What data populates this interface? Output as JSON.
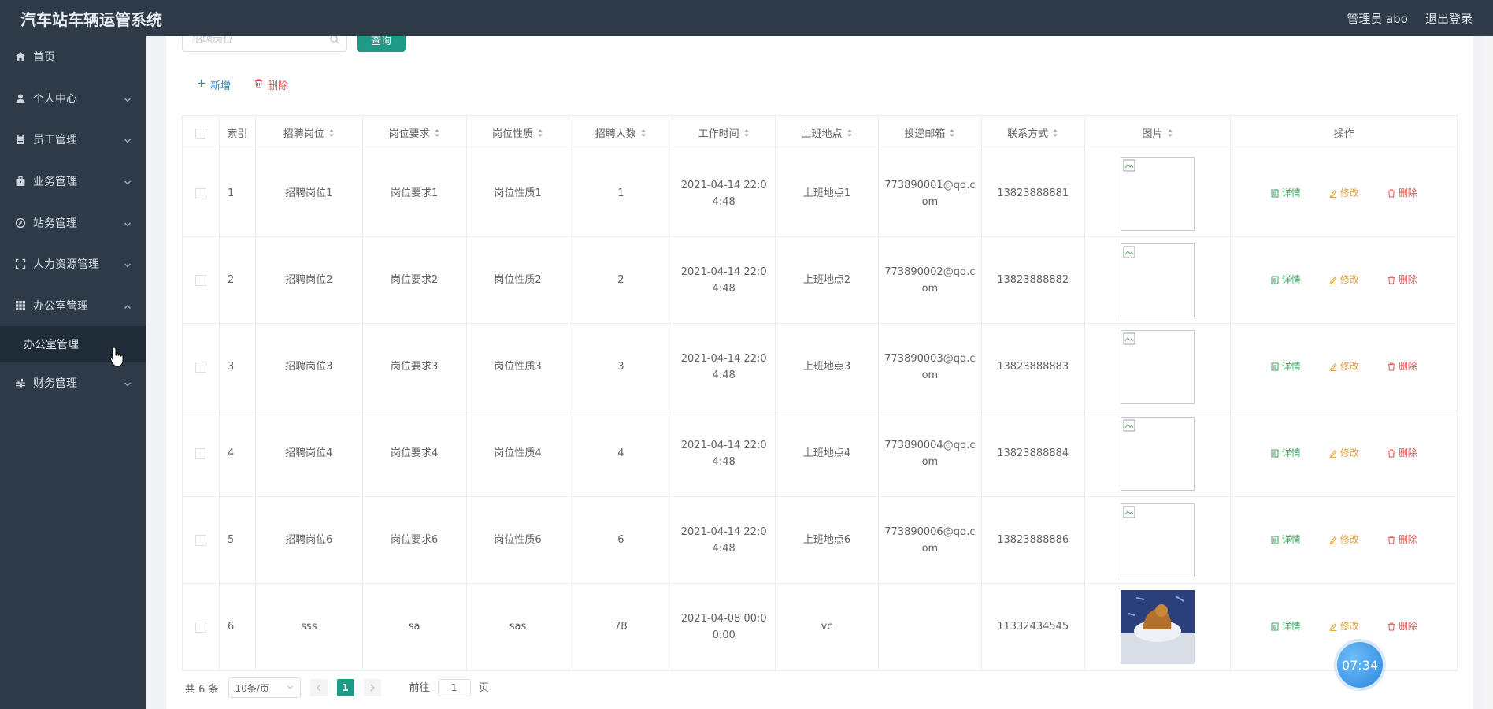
{
  "app": {
    "title": "汽车站车辆运管系统",
    "user_label": "管理员 abo",
    "logout": "退出登录"
  },
  "sidebar": {
    "items": [
      {
        "label": "首页",
        "icon": "home-icon"
      },
      {
        "label": "个人中心",
        "icon": "user-icon"
      },
      {
        "label": "员工管理",
        "icon": "clipboard-icon"
      },
      {
        "label": "业务管理",
        "icon": "briefcase-icon"
      },
      {
        "label": "站务管理",
        "icon": "compass-icon"
      },
      {
        "label": "人力资源管理",
        "icon": "frame-icon"
      },
      {
        "label": "办公室管理",
        "icon": "grid-icon"
      },
      {
        "label": "财务管理",
        "icon": "sliders-icon"
      }
    ],
    "submenu_label": "办公室管理"
  },
  "search": {
    "placeholder": "招聘岗位",
    "button": "查询"
  },
  "actions": {
    "add": "新增",
    "delete": "删除"
  },
  "table": {
    "headers": [
      "索引",
      "招聘岗位",
      "岗位要求",
      "岗位性质",
      "招聘人数",
      "工作时间",
      "上班地点",
      "投递邮箱",
      "联系方式",
      "图片",
      "操作"
    ],
    "op_labels": {
      "detail": "详情",
      "edit": "修改",
      "remove": "删除"
    },
    "rows": [
      {
        "index": "1",
        "post": "招聘岗位1",
        "req": "岗位要求1",
        "nature": "岗位性质1",
        "count": "1",
        "time": "2021-04-14 22:04:48",
        "place": "上班地点1",
        "email": "773890001@qq.com",
        "phone": "13823888881",
        "image": "broken"
      },
      {
        "index": "2",
        "post": "招聘岗位2",
        "req": "岗位要求2",
        "nature": "岗位性质2",
        "count": "2",
        "time": "2021-04-14 22:04:48",
        "place": "上班地点2",
        "email": "773890002@qq.com",
        "phone": "13823888882",
        "image": "broken"
      },
      {
        "index": "3",
        "post": "招聘岗位3",
        "req": "岗位要求3",
        "nature": "岗位性质3",
        "count": "3",
        "time": "2021-04-14 22:04:48",
        "place": "上班地点3",
        "email": "773890003@qq.com",
        "phone": "13823888883",
        "image": "broken"
      },
      {
        "index": "4",
        "post": "招聘岗位4",
        "req": "岗位要求4",
        "nature": "岗位性质4",
        "count": "4",
        "time": "2021-04-14 22:04:48",
        "place": "上班地点4",
        "email": "773890004@qq.com",
        "phone": "13823888884",
        "image": "broken"
      },
      {
        "index": "5",
        "post": "招聘岗位6",
        "req": "岗位要求6",
        "nature": "岗位性质6",
        "count": "6",
        "time": "2021-04-14 22:04:48",
        "place": "上班地点6",
        "email": "773890006@qq.com",
        "phone": "13823888886",
        "image": "broken"
      },
      {
        "index": "6",
        "post": "sss",
        "req": "sa",
        "nature": "sas",
        "count": "78",
        "time": "2021-04-08 00:00:00",
        "place": "vc",
        "email": "",
        "phone": "11332434545",
        "image": "photo"
      }
    ]
  },
  "pagination": {
    "total": "共 6 条",
    "page_size": "10条/页",
    "current": "1",
    "goto_prefix": "前往",
    "goto_value": "1",
    "goto_suffix": "页"
  },
  "clock": "07:34",
  "colors": {
    "sidebar_bg": "#2e3a47",
    "primary": "#1f9a86",
    "detail": "#3aa55b",
    "edit": "#e6a23c",
    "danger": "#e25555"
  }
}
